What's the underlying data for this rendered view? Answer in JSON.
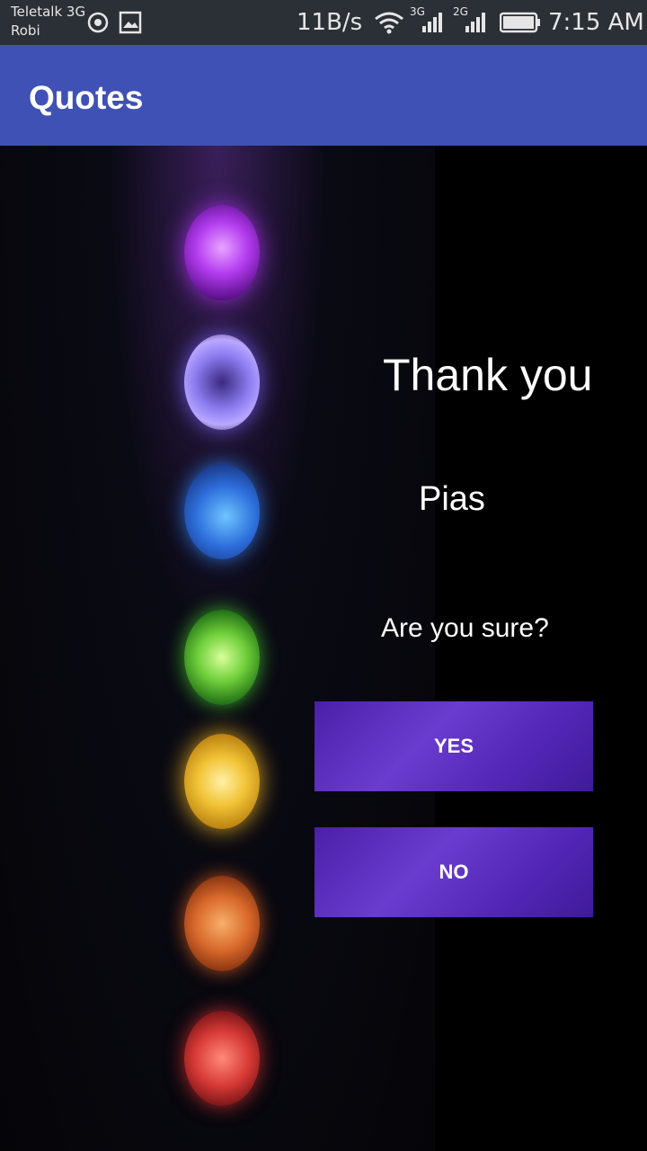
{
  "status_bar": {
    "carrier_line1": "Teletalk 3G",
    "carrier_line2": "Robi",
    "speed": "11B/s",
    "net1": "3G",
    "net2": "2G",
    "time": "7:15 AM"
  },
  "app_bar": {
    "title": "Quotes"
  },
  "main": {
    "thank_text": "Thank you",
    "name_text": "Pias",
    "question_text": "Are you sure?",
    "yes_label": "YES",
    "no_label": "NO"
  },
  "colors": {
    "app_bar": "#3f51b5",
    "status_bar": "#2b2f36",
    "button": "#5427b8"
  }
}
